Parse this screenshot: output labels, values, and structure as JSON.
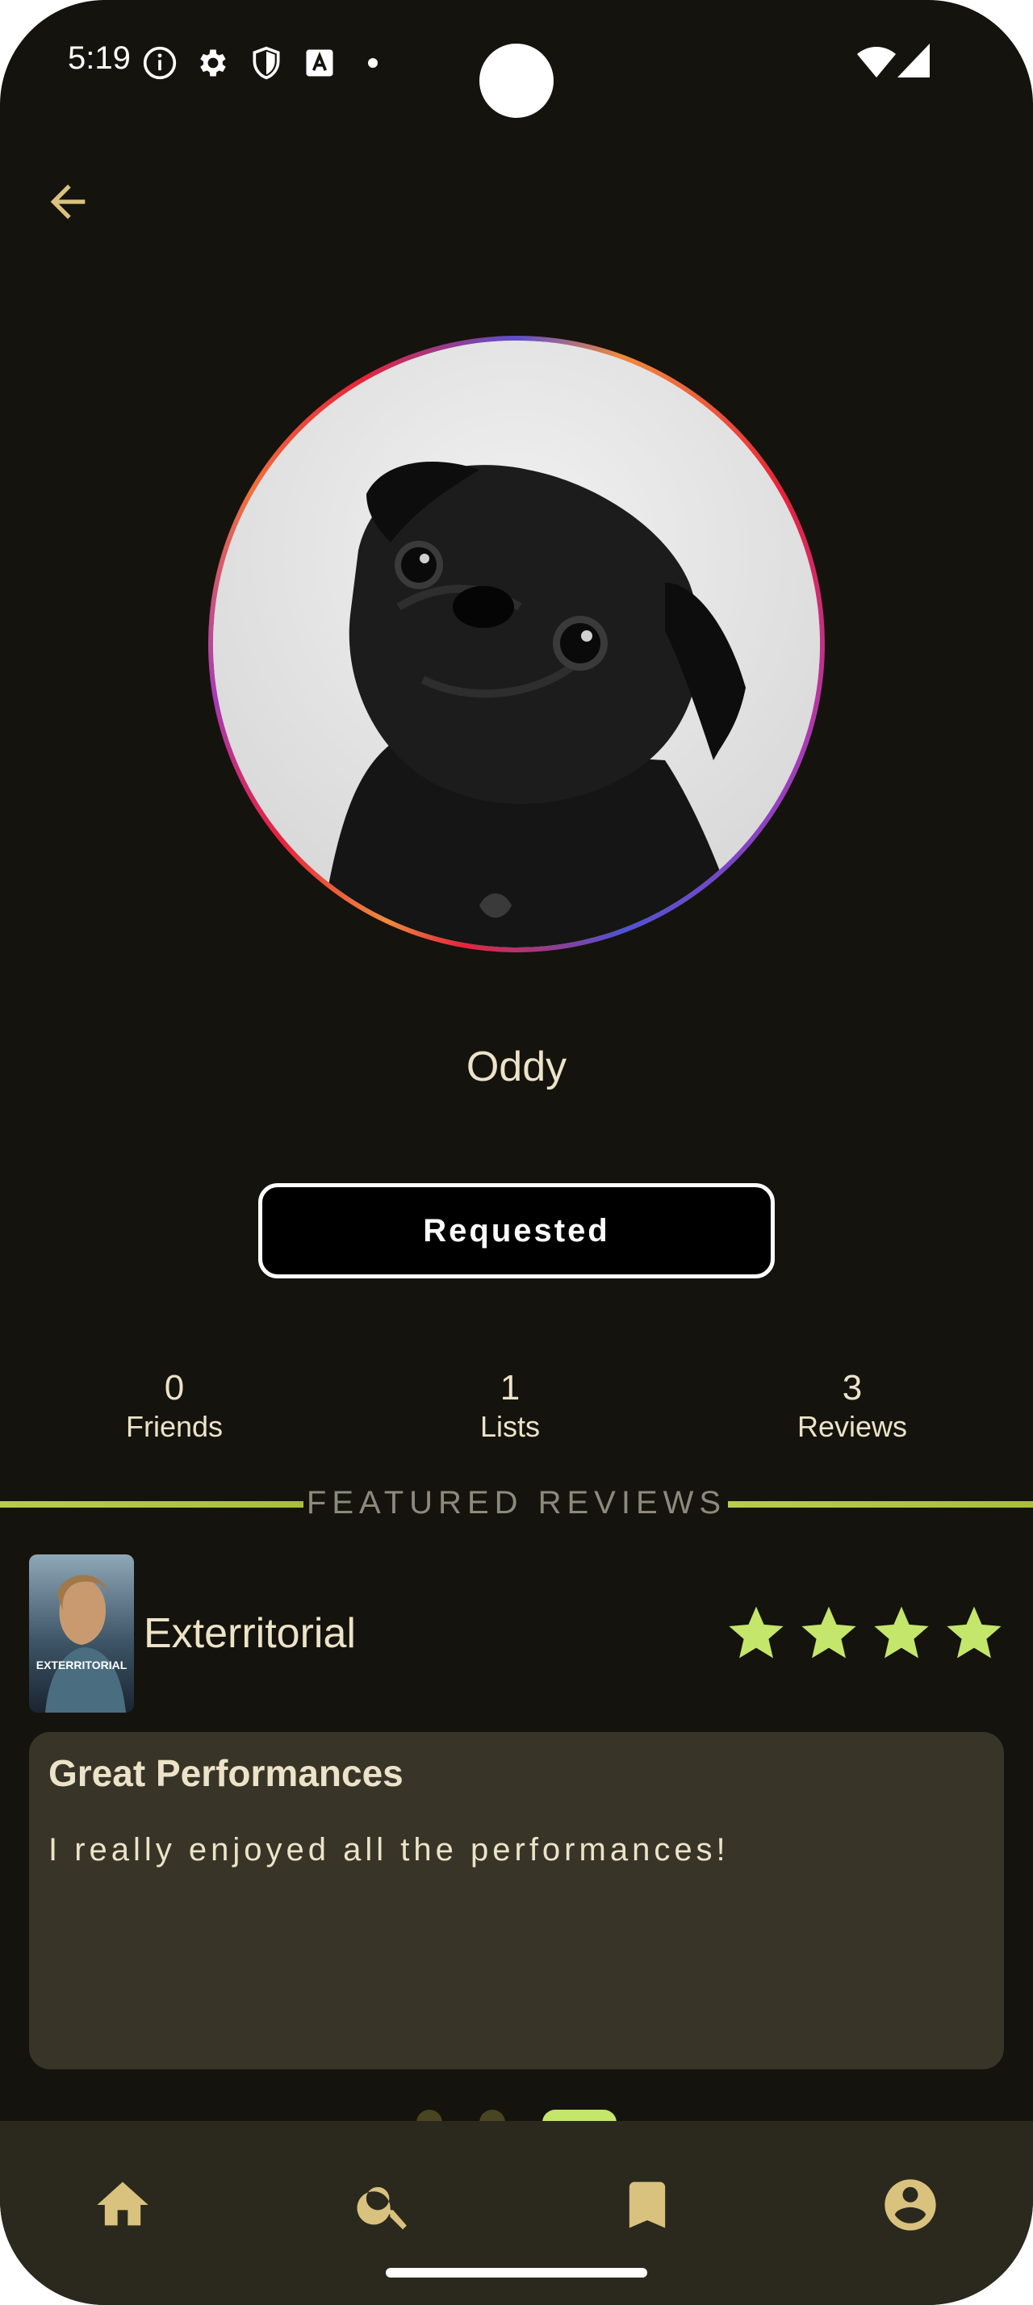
{
  "status_bar": {
    "time": "5:19"
  },
  "profile": {
    "username": "Oddy",
    "action_button_label": "Requested"
  },
  "stats": [
    {
      "count": "0",
      "label": "Friends"
    },
    {
      "count": "1",
      "label": "Lists"
    },
    {
      "count": "3",
      "label": "Reviews"
    }
  ],
  "featured": {
    "section_label": "FEATURED REVIEWS",
    "review": {
      "movie_title": "Exterritorial",
      "poster_text": "EXTERRITORIAL",
      "rating": 4,
      "rating_max": 4,
      "title": "Great Performances",
      "body": "I really enjoyed all the performances!"
    },
    "pager": {
      "pages": 3,
      "current": 3
    }
  },
  "bottom_nav": [
    {
      "icon": "home-icon"
    },
    {
      "icon": "search-icon"
    },
    {
      "icon": "bookmark-icon"
    },
    {
      "icon": "account-icon"
    }
  ],
  "colors": {
    "background": "#15130d",
    "accent": "#c3e66b",
    "text": "#ece3c8",
    "icon": "#d9c27e",
    "card": "#383528",
    "nav_bar": "#2b291d"
  }
}
